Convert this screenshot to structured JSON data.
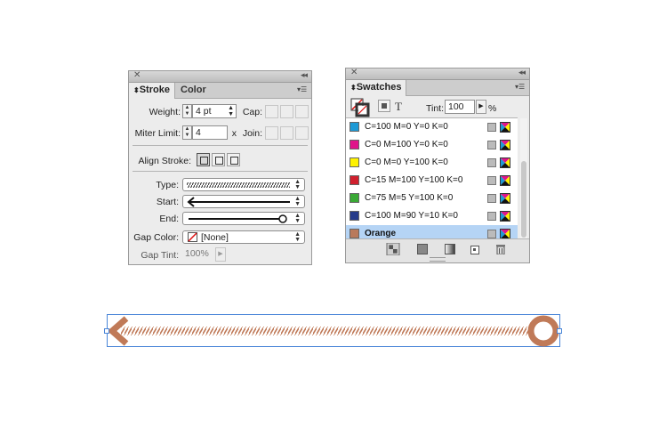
{
  "stroke_panel": {
    "tabs": [
      {
        "label": "Stroke",
        "active": true
      },
      {
        "label": "Color",
        "active": false
      }
    ],
    "weight": {
      "label": "Weight:",
      "value": "4 pt"
    },
    "cap_label": "Cap:",
    "miter": {
      "label": "Miter Limit:",
      "value": "4",
      "suffix": "x"
    },
    "join_label": "Join:",
    "align_label": "Align Stroke:",
    "type_label": "Type:",
    "start_label": "Start:",
    "end_label": "End:",
    "gap_color": {
      "label": "Gap Color:",
      "value": "[None]"
    },
    "gap_tint": {
      "label": "Gap Tint:",
      "value": "100%"
    }
  },
  "swatches_panel": {
    "tab": "Swatches",
    "tint": {
      "label": "Tint:",
      "value": "100",
      "unit": "%"
    },
    "swatches": [
      {
        "name": "C=100 M=0 Y=0 K=0",
        "color": "#1e9ad6",
        "selected": false
      },
      {
        "name": "C=0 M=100 Y=0 K=0",
        "color": "#e0148a",
        "selected": false
      },
      {
        "name": "C=0 M=0 Y=100 K=0",
        "color": "#fff200",
        "selected": false
      },
      {
        "name": "C=15 M=100 Y=100 K=0",
        "color": "#d0202e",
        "selected": false
      },
      {
        "name": "C=75 M=5 Y=100 K=0",
        "color": "#3aa935",
        "selected": false
      },
      {
        "name": "C=100 M=90 Y=10 K=0",
        "color": "#263b8a",
        "selected": false
      },
      {
        "name": "Orange",
        "color": "#b97a5c",
        "selected": true
      }
    ]
  },
  "colors": {
    "stroke_color": "#c07a58",
    "selection": "#4a86d8"
  }
}
